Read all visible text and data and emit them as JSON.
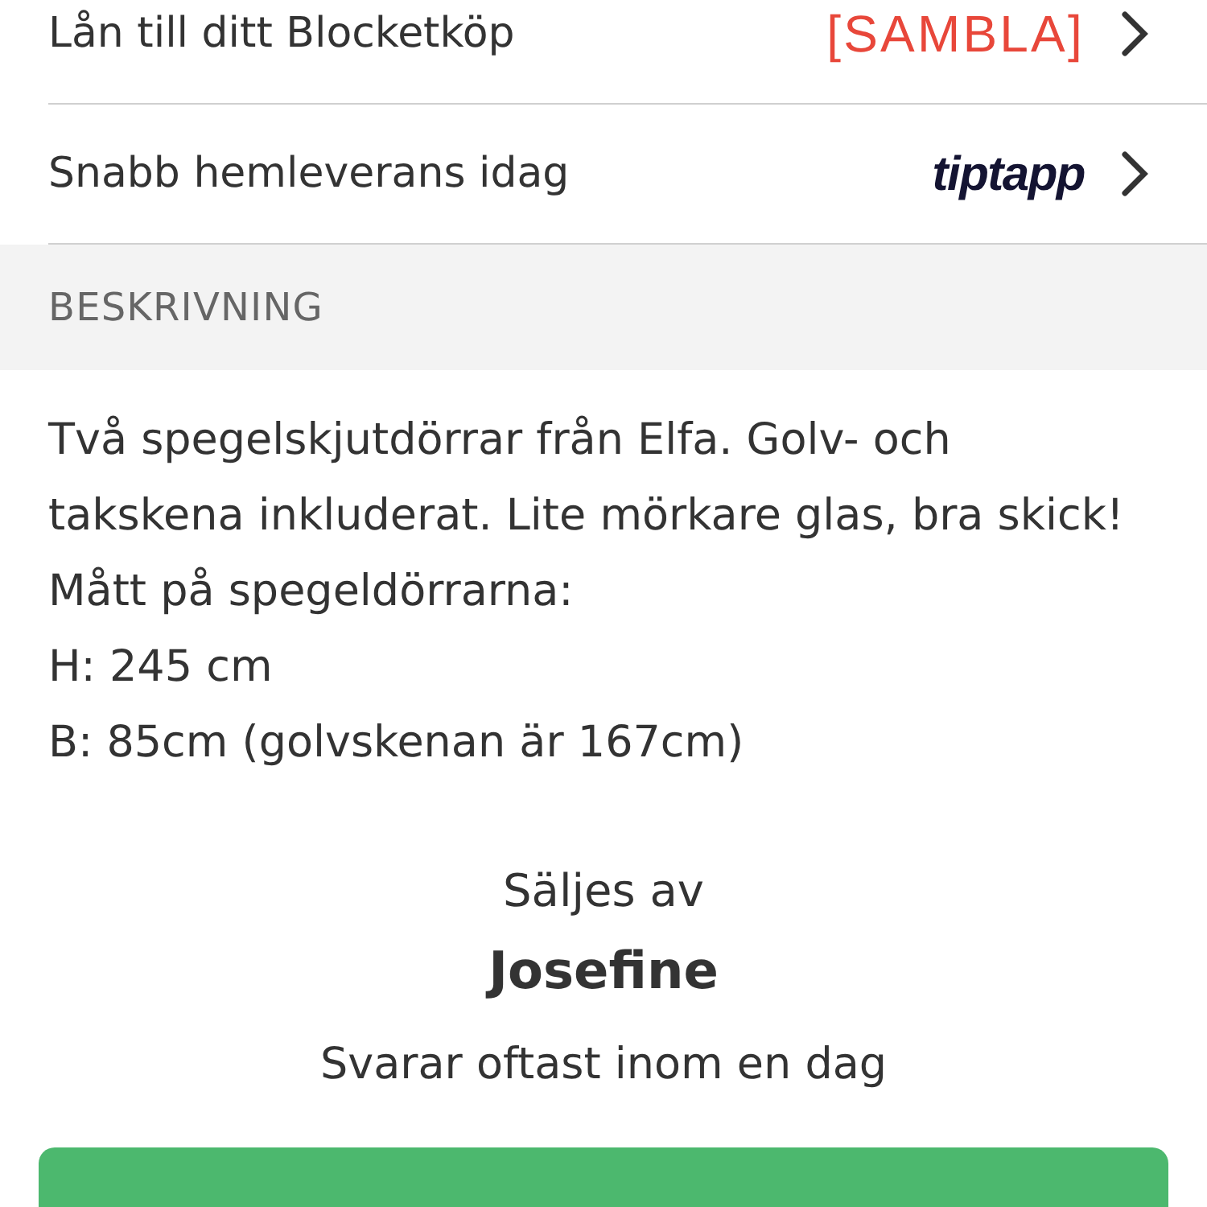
{
  "promo_rows": [
    {
      "label": "Lån till ditt Blocketköp",
      "logo": {
        "kind": "sambla",
        "text": "[SAMBLA]"
      }
    },
    {
      "label": "Snabb hemleverans idag",
      "logo": {
        "kind": "tiptapp",
        "text": "tiptapp"
      }
    }
  ],
  "section_header": "BESKRIVNING",
  "description_lines": [
    "Två spegelskjutdörrar från Elfa. Golv- och",
    "takskena inkluderat. Lite mörkare glas, bra skick!",
    "Mått på spegeldörrarna:",
    "H: 245 cm",
    "B: 85cm (golvskenan är 167cm)"
  ],
  "seller": {
    "caption": "Säljes av",
    "name": "Josefine",
    "response_time": "Svarar oftast inom en dag"
  }
}
